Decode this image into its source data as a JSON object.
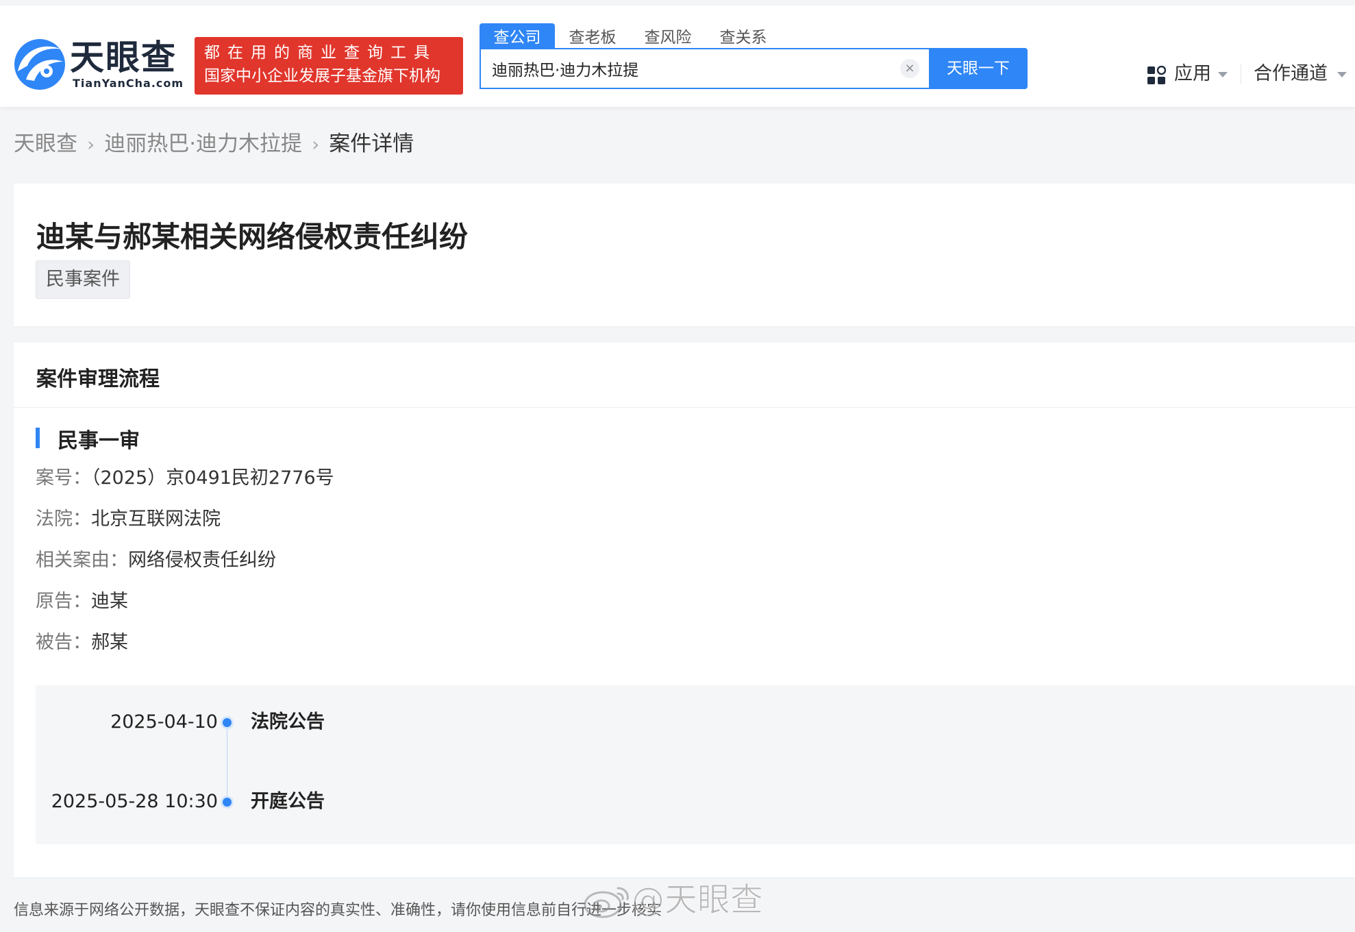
{
  "header": {
    "logo": {
      "name": "天眼查",
      "domain": "TianYanCha.com"
    },
    "slogan": {
      "line1": "都在用的商业查询工具",
      "line2": "国家中小企业发展子基金旗下机构"
    },
    "tabs": [
      {
        "label": "查公司",
        "active": true
      },
      {
        "label": "查老板",
        "active": false
      },
      {
        "label": "查风险",
        "active": false
      },
      {
        "label": "查关系",
        "active": false
      }
    ],
    "search": {
      "value": "迪丽热巴·迪力木拉提",
      "button_label": "天眼一下"
    },
    "nav": {
      "apps_label": "应用",
      "partner_label": "合作通道"
    }
  },
  "breadcrumb": [
    {
      "label": "天眼查"
    },
    {
      "label": "迪丽热巴·迪力木拉提"
    },
    {
      "label": "案件详情"
    }
  ],
  "case": {
    "title": "迪某与郝某相关网络侵权责任纠纷",
    "tag": "民事案件"
  },
  "process": {
    "section_title": "案件审理流程",
    "stage": {
      "title": "民事一审",
      "fields": [
        {
          "label": "案号：",
          "value": "（2025）京0491民初2776号"
        },
        {
          "label": "法院：",
          "value": "北京互联网法院"
        },
        {
          "label": "相关案由：",
          "value": "网络侵权责任纠纷"
        },
        {
          "label": "原告：",
          "value": "迪某"
        },
        {
          "label": "被告：",
          "value": "郝某"
        }
      ],
      "timeline": [
        {
          "date": "2025-04-10",
          "event": "法院公告"
        },
        {
          "date": "2025-05-28 10:30",
          "event": "开庭公告"
        }
      ]
    }
  },
  "footer": {
    "disclaimer": "信息来源于网络公开数据，天眼查不保证内容的真实性、准确性，请你使用信息前自行进一步核实",
    "watermark": "@天眼查"
  },
  "colors": {
    "accent": "#2f86f6",
    "slogan_bg": "#e1362c",
    "page_bg": "#f4f5f7"
  }
}
